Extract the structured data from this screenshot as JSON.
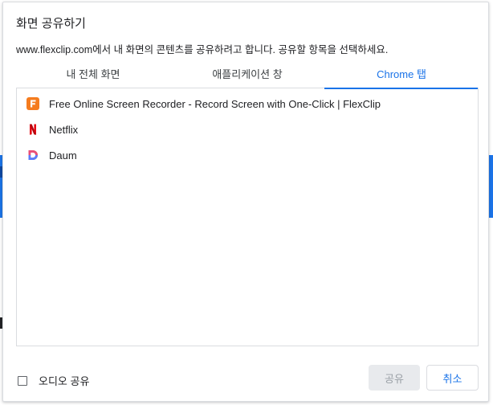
{
  "dialog": {
    "title": "화면 공유하기",
    "subtitle": "www.flexclip.com에서 내 화면의 콘텐츠를 공유하려고 합니다. 공유할 항목을 선택하세요."
  },
  "tabs": [
    {
      "label": "내 전체 화면",
      "active": false
    },
    {
      "label": "애플리케이션 창",
      "active": false
    },
    {
      "label": "Chrome 탭",
      "active": true
    }
  ],
  "chrome_tabs": [
    {
      "label": "Free Online Screen Recorder - Record Screen with One-Click | FlexClip",
      "icon": "flexclip-favicon"
    },
    {
      "label": "Netflix",
      "icon": "netflix-favicon"
    },
    {
      "label": "Daum",
      "icon": "daum-favicon"
    }
  ],
  "footer": {
    "audio_label": "오디오 공유",
    "audio_checked": false,
    "share_label": "공유",
    "cancel_label": "취소"
  },
  "colors": {
    "accent": "#1a73e8",
    "flexclip": "#f57c1f",
    "netflix": "#e50914"
  }
}
